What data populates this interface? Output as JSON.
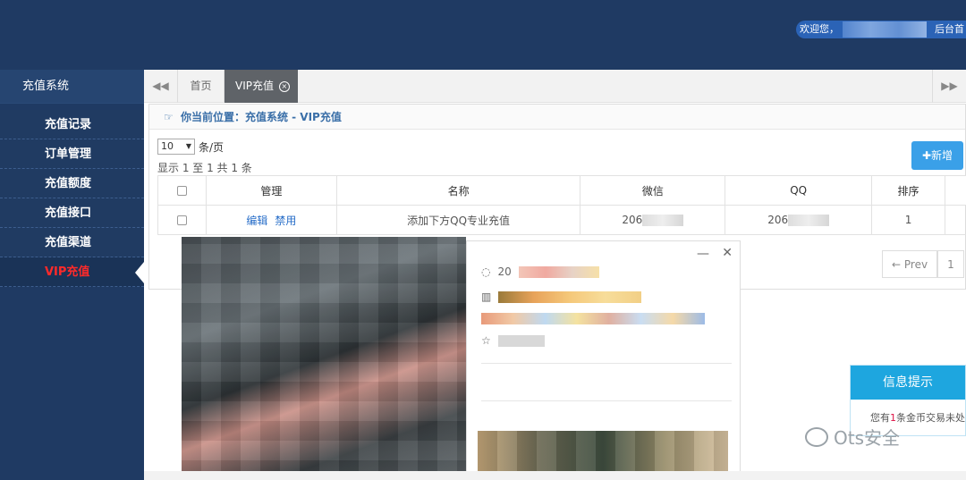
{
  "header": {
    "welcome_prefix": "欢迎您，",
    "home_link": "后台首",
    "colors": {
      "bar": "#1f3a63",
      "pill": "#2b63b6"
    }
  },
  "sidebar": {
    "title": "充值系统",
    "items": [
      {
        "label": "充值记录",
        "active": false
      },
      {
        "label": "订单管理",
        "active": false
      },
      {
        "label": "充值额度",
        "active": false
      },
      {
        "label": "充值接口",
        "active": false
      },
      {
        "label": "充值渠道",
        "active": false
      },
      {
        "label": "VIP充值",
        "active": true
      }
    ]
  },
  "tabs": {
    "left_arrow": "◀◀",
    "home": "首页",
    "active": "VIP充值",
    "close_glyph": "×",
    "right_arrow": "▶▶"
  },
  "breadcrumb": {
    "icon": "☞",
    "text": "你当前位置：充值系统 - VIP充值"
  },
  "controls": {
    "page_size": "10",
    "page_size_unit": "条/页",
    "showing": "显示 1 至 1 共 1 条",
    "add_button": "✚新增"
  },
  "table": {
    "headers": [
      "管理",
      "名称",
      "微信",
      "QQ",
      "排序"
    ],
    "rows": [
      {
        "edit": "编辑",
        "disable": "禁用",
        "name": "添加下方QQ专业充值",
        "wechat": "206",
        "qq": "206",
        "order": "1"
      }
    ]
  },
  "pager": {
    "prev": "← Prev",
    "page": "1"
  },
  "card": {
    "minimize": "—",
    "close": "✕",
    "id_prefix": "20"
  },
  "toast": {
    "title": "信息提示",
    "body_prefix": "您有",
    "body_number": "1",
    "body_suffix": "条金币交易未处"
  },
  "watermark": {
    "text": "Ots安全"
  }
}
